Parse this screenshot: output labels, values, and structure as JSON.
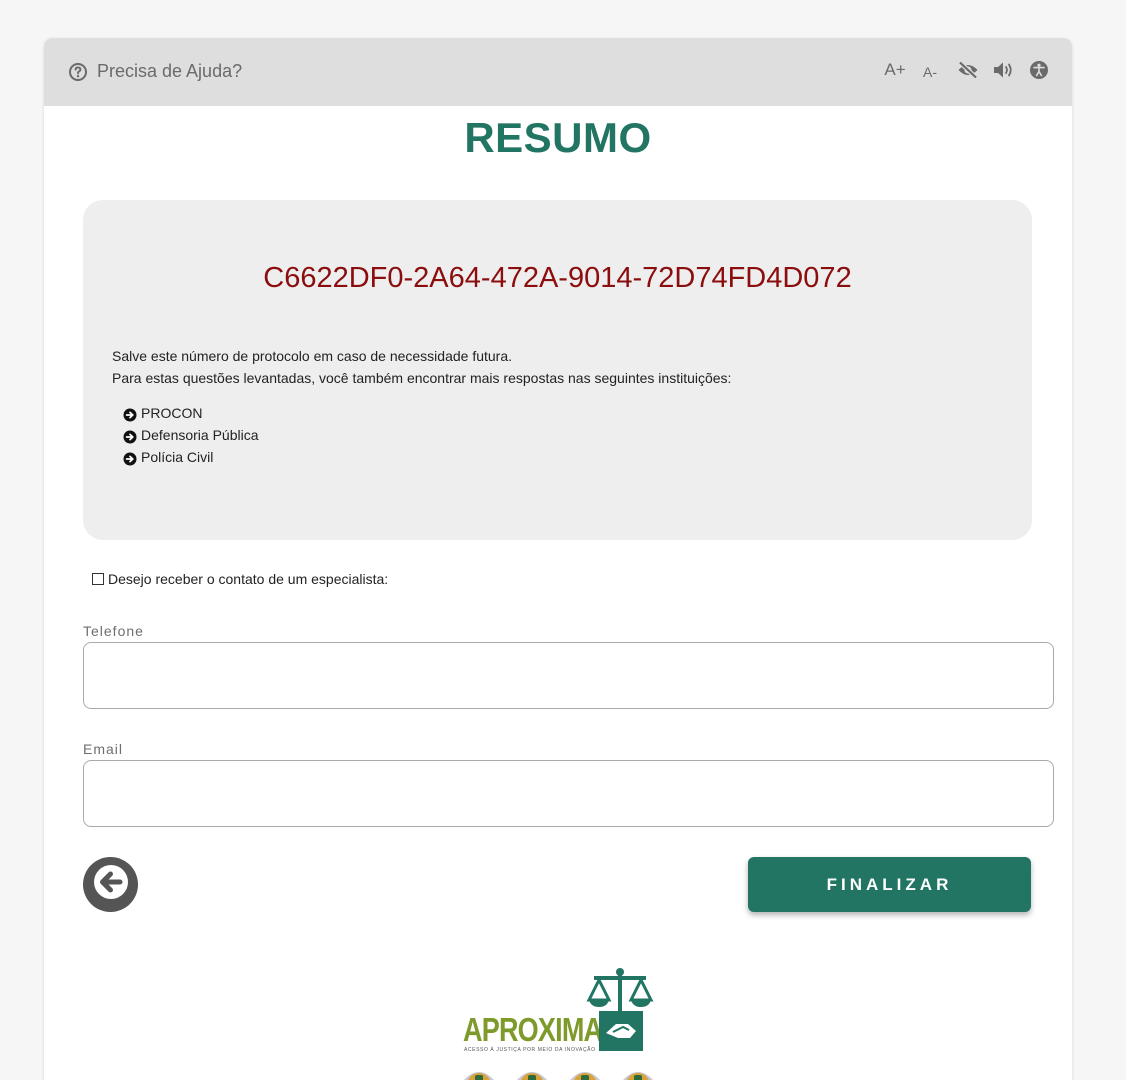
{
  "header": {
    "help_label": "Precisa de Ajuda?",
    "font_increase": "A+",
    "font_decrease": "A-",
    "icons": [
      "help-circle-icon",
      "eye-slash-icon",
      "volume-icon",
      "accessibility-icon"
    ]
  },
  "page": {
    "title": "RESUMO"
  },
  "summary": {
    "protocol": "C6622DF0-2A64-472A-9014-72D74FD4D072",
    "save_notice": "Salve este número de protocolo em caso de necessidade futura.",
    "more_info": "Para estas questões levantadas, você também encontrar mais respostas nas seguintes instituições:",
    "institutions": [
      {
        "label": "PROCON"
      },
      {
        "label": "Defensoria Pública"
      },
      {
        "label": "Polícia Civil"
      }
    ]
  },
  "contact": {
    "checkbox_label": "Desejo receber o contato de um especialista:",
    "checked": false
  },
  "form": {
    "phone_label": "Telefone",
    "phone_value": "",
    "email_label": "Email",
    "email_value": ""
  },
  "actions": {
    "finalize_label": "FINALIZAR"
  },
  "footer": {
    "logo_text": "APROXIMA",
    "logo_tagline": "ACESSO À JUSTIÇA POR MEIO DA INOVAÇÃO"
  },
  "colors": {
    "brand_green": "#217562",
    "logo_olive": "#7d9a2a",
    "protocol_red": "#8b0d0d"
  }
}
